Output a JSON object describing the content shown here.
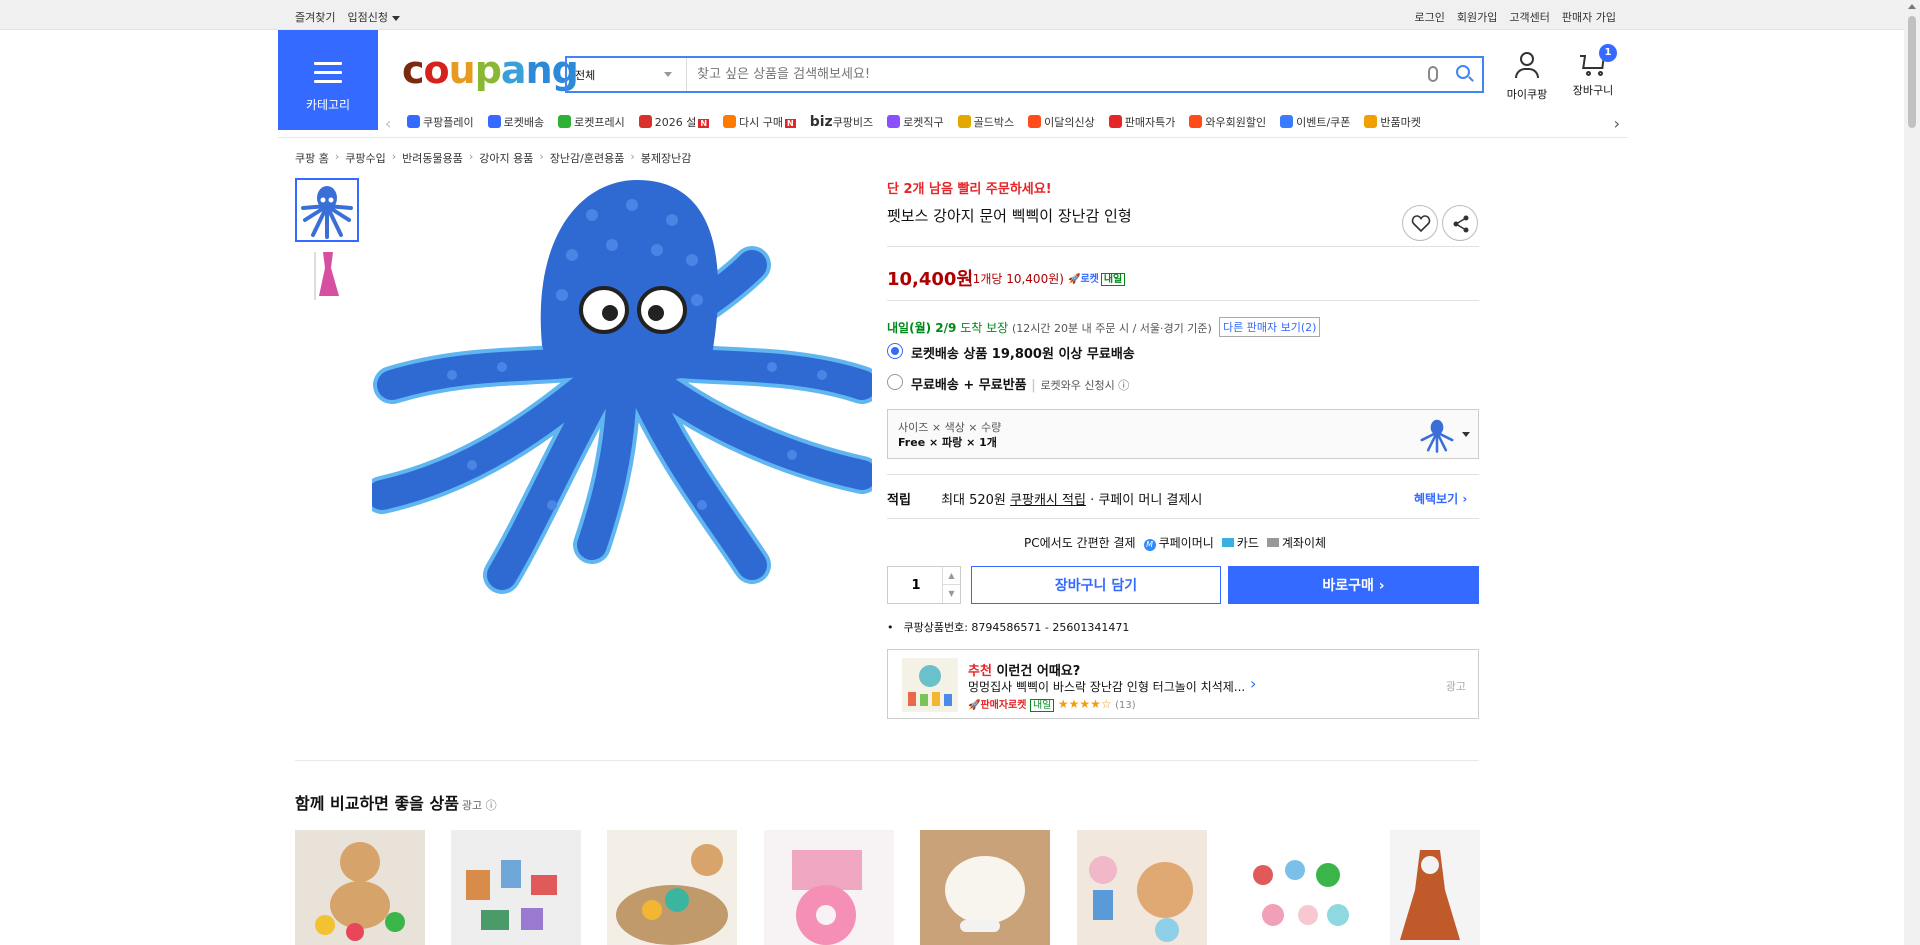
{
  "topbar": {
    "favorites": "즐겨찾기",
    "seller_apply": "입점신청",
    "login": "로그인",
    "signup": "회원가입",
    "customer_center": "고객센터",
    "seller_signup": "판매자 가입"
  },
  "header": {
    "category_label": "카테고리",
    "logo": "coupang",
    "search_scope": "전체",
    "search_placeholder": "찾고 싶은 상품을 검색해보세요!",
    "my_coupang": "마이쿠팡",
    "cart": "장바구니",
    "cart_count": "1"
  },
  "nav": {
    "items": [
      {
        "label": "쿠팡플레이",
        "color": "#346aff"
      },
      {
        "label": "로켓배송",
        "color": "#346aff"
      },
      {
        "label": "로켓프레시",
        "color": "#2eb135"
      },
      {
        "label": "2026 설",
        "color": "#d9322c",
        "badge": "N"
      },
      {
        "label": "다시 구매",
        "color": "#ff7a00",
        "badge": "N"
      },
      {
        "label": "쿠팡비즈",
        "prefix": "biz"
      },
      {
        "label": "로켓직구",
        "color": "#8a4fff"
      },
      {
        "label": "골드박스",
        "color": "#e3a800"
      },
      {
        "label": "이달의신상",
        "color": "#ff4a1a"
      },
      {
        "label": "판매자특가",
        "color": "#e52528"
      },
      {
        "label": "와우회원할인",
        "color": "#ff4a1a"
      },
      {
        "label": "이벤트/쿠폰",
        "color": "#3a7cff"
      },
      {
        "label": "반품마켓",
        "color": "#f0a000"
      }
    ]
  },
  "breadcrumb": [
    "쿠팡 홈",
    "쿠팡수입",
    "반려동물용품",
    "강아지 용품",
    "장난감/훈련용품",
    "봉제장난감"
  ],
  "product": {
    "urgent": "단 2개 남음 빨리 주문하세요!",
    "name": "펫보스 강아지 문어 삑삑이 장난감 인형",
    "price": "10,400원",
    "unit_price": "(1개당 10,400원)",
    "rocket_label": "로켓",
    "rocket_tag": "내일",
    "delivery_date": "내일(월) 2/9",
    "delivery_guarantee": "도착 보장",
    "delivery_note": "(12시간 20분 내 주문 시 / 서울·경기 기준)",
    "other_sellers": "다른 판매자 보기(2)",
    "option1": "로켓배송 상품 19,800원 이상 무료배송",
    "option2": "무료배송 + 무료반품",
    "option2_sub": "로켓와우 신청시 ⓘ",
    "variant_header": "사이즈 × 색상 × 수량",
    "variant_value": "Free × 파랑 × 1개",
    "reward_label": "적립",
    "reward_text": "최대 520원",
    "reward_link": "쿠팡캐시 적립",
    "reward_tail": "· 쿠페이 머니 결제시",
    "benefit": "혜택보기 ›",
    "pay_label": "PC에서도 간편한 결제",
    "pay_methods": [
      "쿠페이머니",
      "카드",
      "계좌이체"
    ],
    "qty": "1",
    "add_cart": "장바구니 담기",
    "buy_now": "바로구매 ›",
    "product_id": "쿠팡상품번호: 8794586571 - 25601341471"
  },
  "reco": {
    "tag": "추천",
    "title": "이런건 어때요?",
    "item": "멍멍집사 삑삑이 바스락 장난감 인형 터그놀이 치석제...",
    "seller": "판매자로켓",
    "seller_tag": "내일",
    "stars": "★★★★☆",
    "count": "(13)",
    "ad": "광고"
  },
  "compare": {
    "title": "함께 비교하면 좋을 상품",
    "ad": "광고 ⓘ"
  }
}
